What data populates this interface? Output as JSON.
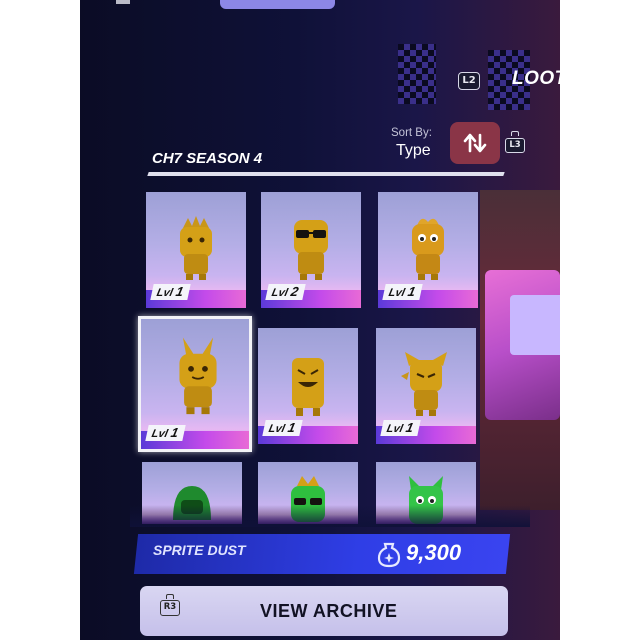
{
  "nav": {
    "left_badge": "L2",
    "next_tab": "LOOT"
  },
  "sort": {
    "label": "Sort By:",
    "value": "Type",
    "badge": "L3",
    "button_icon": "sort-arrows-icon"
  },
  "section": {
    "title": "CH7 SEASON 4"
  },
  "grid": {
    "level_prefix": "Lvl",
    "tiles": [
      {
        "level": "1",
        "sprite": "crowned-gold-sprite"
      },
      {
        "level": "2",
        "sprite": "sunglasses-gold-sprite"
      },
      {
        "level": "1",
        "sprite": "tufted-gold-sprite"
      },
      {
        "level": "1",
        "sprite": "bunny-ear-gold-sprite",
        "selected": true
      },
      {
        "level": "1",
        "sprite": "grinning-gold-sprite"
      },
      {
        "level": "1",
        "sprite": "spiky-gold-sprite"
      },
      {
        "sprite": "green-hood-sprite"
      },
      {
        "sprite": "green-crowned-sprite"
      },
      {
        "sprite": "green-eared-sprite"
      }
    ]
  },
  "currency": {
    "label": "SPRITE DUST",
    "value": "9,300",
    "icon": "sprite-dust-icon"
  },
  "archive": {
    "badge": "R3",
    "label": "VIEW ARCHIVE"
  },
  "colors": {
    "sort_button": "#8a3547",
    "dust_bar": "#2f3ee6",
    "archive_button": "#d9d6f2",
    "gold": "#d4a017",
    "green": "#2fbf3f"
  }
}
